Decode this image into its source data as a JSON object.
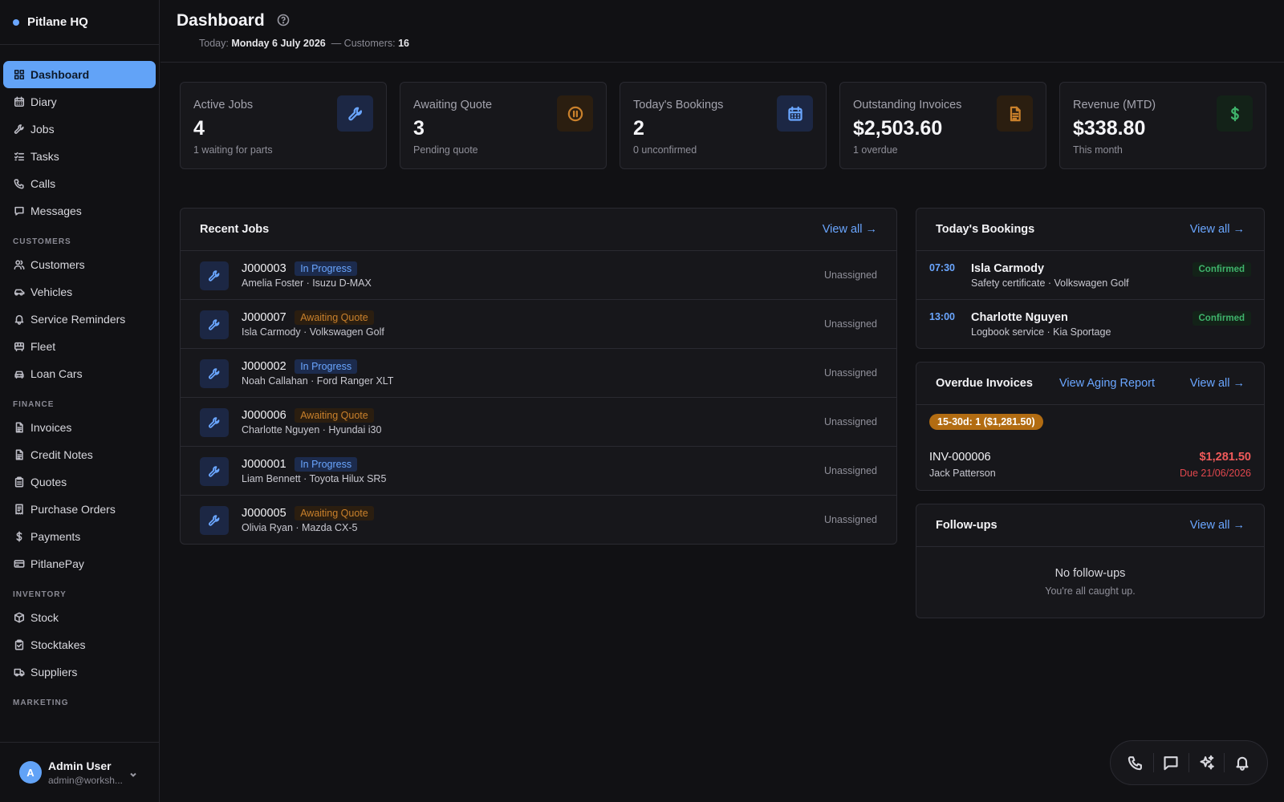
{
  "brand": {
    "name": "Pitlane HQ"
  },
  "sidebar": {
    "main": [
      {
        "label": "Dashboard",
        "icon": "grid-icon",
        "active": true
      },
      {
        "label": "Diary",
        "icon": "calendar-icon"
      },
      {
        "label": "Jobs",
        "icon": "wrench-icon"
      },
      {
        "label": "Tasks",
        "icon": "checklist-icon"
      },
      {
        "label": "Calls",
        "icon": "phone-icon"
      },
      {
        "label": "Messages",
        "icon": "message-icon"
      }
    ],
    "customers_section": "CUSTOMERS",
    "customers": [
      {
        "label": "Customers",
        "icon": "users-icon"
      },
      {
        "label": "Vehicles",
        "icon": "car-icon"
      },
      {
        "label": "Service Reminders",
        "icon": "bell-icon"
      },
      {
        "label": "Fleet",
        "icon": "bus-icon"
      },
      {
        "label": "Loan Cars",
        "icon": "car-front-icon"
      }
    ],
    "finance_section": "FINANCE",
    "finance": [
      {
        "label": "Invoices",
        "icon": "document-icon"
      },
      {
        "label": "Credit Notes",
        "icon": "document-icon"
      },
      {
        "label": "Quotes",
        "icon": "clipboard-icon"
      },
      {
        "label": "Purchase Orders",
        "icon": "receipt-icon"
      },
      {
        "label": "Payments",
        "icon": "dollar-icon"
      },
      {
        "label": "PitlanePay",
        "icon": "credit-card-icon"
      }
    ],
    "inventory_section": "INVENTORY",
    "inventory": [
      {
        "label": "Stock",
        "icon": "box-icon"
      },
      {
        "label": "Stocktakes",
        "icon": "clipboard-check-icon"
      },
      {
        "label": "Suppliers",
        "icon": "truck-icon"
      }
    ],
    "marketing_section": "MARKETING"
  },
  "user": {
    "initial": "A",
    "name": "Admin User",
    "email": "admin@worksh..."
  },
  "header": {
    "title": "Dashboard",
    "today_label": "Today:",
    "today_value": "Monday 6 July 2026",
    "customers_label": "— Customers:",
    "customers_value": "16"
  },
  "stats": [
    {
      "label": "Active Jobs",
      "value": "4",
      "sub": "1 waiting for parts",
      "icon": "wrench-icon",
      "color": "#6aa6ff",
      "bg": "#1c2744"
    },
    {
      "label": "Awaiting Quote",
      "value": "3",
      "sub": "Pending quote",
      "icon": "pause-circle-icon",
      "color": "#c9802b",
      "bg": "#2b1e10"
    },
    {
      "label": "Today's Bookings",
      "value": "2",
      "sub": "0 unconfirmed",
      "icon": "calendar-icon",
      "color": "#6aa6ff",
      "bg": "#1c2744"
    },
    {
      "label": "Outstanding Invoices",
      "value": "$2,503.60",
      "sub": "1 overdue",
      "icon": "document-icon",
      "color": "#c9802b",
      "bg": "#2b1e10"
    },
    {
      "label": "Revenue (MTD)",
      "value": "$338.80",
      "sub": "This month",
      "icon": "dollar-icon",
      "color": "#3fb36b",
      "bg": "#132218"
    }
  ],
  "recent_jobs": {
    "title": "Recent Jobs",
    "view_all": "View all →",
    "rows": [
      {
        "id": "J000003",
        "status": "In Progress",
        "status_color": "blue",
        "desc": "Amelia Foster · Isuzu D-MAX",
        "assignee": "Unassigned"
      },
      {
        "id": "J000007",
        "status": "Awaiting Quote",
        "status_color": "orange",
        "desc": "Isla Carmody · Volkswagen Golf",
        "assignee": "Unassigned"
      },
      {
        "id": "J000002",
        "status": "In Progress",
        "status_color": "blue",
        "desc": "Noah Callahan · Ford Ranger XLT",
        "assignee": "Unassigned"
      },
      {
        "id": "J000006",
        "status": "Awaiting Quote",
        "status_color": "orange",
        "desc": "Charlotte Nguyen · Hyundai i30",
        "assignee": "Unassigned"
      },
      {
        "id": "J000001",
        "status": "In Progress",
        "status_color": "blue",
        "desc": "Liam Bennett · Toyota Hilux SR5",
        "assignee": "Unassigned"
      },
      {
        "id": "J000005",
        "status": "Awaiting Quote",
        "status_color": "orange",
        "desc": "Olivia Ryan · Mazda CX-5",
        "assignee": "Unassigned"
      }
    ]
  },
  "bookings": {
    "title": "Today's Bookings",
    "view_all": "View all →",
    "rows": [
      {
        "time": "07:30",
        "name": "Isla Carmody",
        "desc": "Safety certificate · Volkswagen Golf",
        "status": "Confirmed"
      },
      {
        "time": "13:00",
        "name": "Charlotte Nguyen",
        "desc": "Logbook service · Kia Sportage",
        "status": "Confirmed"
      }
    ]
  },
  "overdue": {
    "title": "Overdue Invoices",
    "aging_link": "View Aging Report",
    "view_all": "View all →",
    "aging_badge": "15-30d: 1 ($1,281.50)",
    "invoice": {
      "id": "INV-000006",
      "customer": "Jack Patterson",
      "amount": "$1,281.50",
      "due": "Due 21/06/2026"
    }
  },
  "followups": {
    "title": "Follow-ups",
    "view_all": "View all →",
    "empty_title": "No follow-ups",
    "empty_sub": "You're all caught up."
  },
  "toolbar": [
    "phone-icon",
    "chat-icon",
    "sparkles-icon",
    "bell-icon"
  ]
}
